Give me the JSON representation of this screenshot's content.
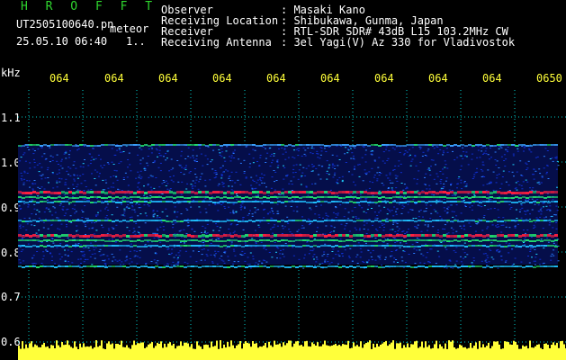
{
  "header": {
    "app_name": "H R O F F T",
    "file_name": "UT2505100640.pn",
    "mode": "meteor",
    "datetime": "25.05.10 06:40",
    "page_marker": "1..",
    "fields": [
      {
        "label": "Observer",
        "value": ": Masaki Kano"
      },
      {
        "label": "Receiving Location",
        "value": ": Shibukawa, Gunma, Japan"
      },
      {
        "label": "Receiver",
        "value": ": RTL-SDR SDR# 43dB L15 103.2MHz CW"
      },
      {
        "label": "Receiving Antenna",
        "value": ": 3el Yagi(V) Az 330 for Vladivostok"
      }
    ]
  },
  "axis": {
    "unit": "kHz",
    "y_ticks": [
      "1.1",
      "1.0",
      "0.9",
      "0.8",
      "0.7",
      "0.6"
    ],
    "x_ticks": [
      "064",
      "064",
      "064",
      "064",
      "064",
      "064",
      "064",
      "064",
      "064",
      "0650"
    ]
  },
  "colors": {
    "background": "#000000",
    "text": "#ffffff",
    "title_green": "#2fd62f",
    "tick_yellow": "#ffff3a",
    "grid_cyan": "#00ffff",
    "noise_blue": "#1030d0",
    "strong_red": "#ff2040"
  }
}
